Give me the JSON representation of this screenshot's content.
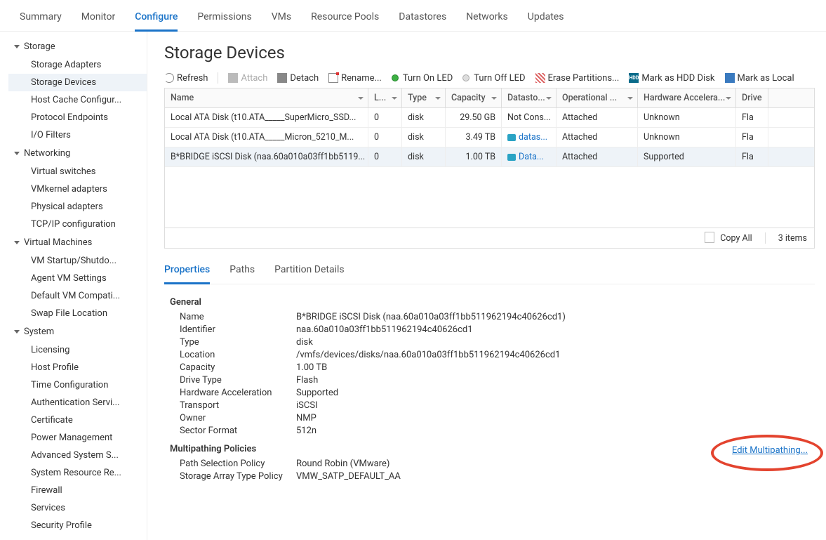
{
  "topTabs": [
    "Summary",
    "Monitor",
    "Configure",
    "Permissions",
    "VMs",
    "Resource Pools",
    "Datastores",
    "Networks",
    "Updates"
  ],
  "topTabActive": "Configure",
  "sidebar": {
    "groups": [
      {
        "label": "Storage",
        "items": [
          "Storage Adapters",
          "Storage Devices",
          "Host Cache Configur...",
          "Protocol Endpoints",
          "I/O Filters"
        ],
        "selected": "Storage Devices"
      },
      {
        "label": "Networking",
        "items": [
          "Virtual switches",
          "VMkernel adapters",
          "Physical adapters",
          "TCP/IP configuration"
        ]
      },
      {
        "label": "Virtual Machines",
        "items": [
          "VM Startup/Shutdo...",
          "Agent VM Settings",
          "Default VM Compati...",
          "Swap File Location"
        ]
      },
      {
        "label": "System",
        "items": [
          "Licensing",
          "Host Profile",
          "Time Configuration",
          "Authentication Servi...",
          "Certificate",
          "Power Management",
          "Advanced System S...",
          "System Resource Re...",
          "Firewall",
          "Services",
          "Security Profile"
        ]
      }
    ]
  },
  "page": {
    "title": "Storage Devices"
  },
  "toolbar": {
    "refresh": "Refresh",
    "attach": "Attach",
    "detach": "Detach",
    "rename": "Rename...",
    "turnOnLed": "Turn On LED",
    "turnOffLed": "Turn Off LED",
    "erase": "Erase Partitions...",
    "markHdd": "Mark as HDD Disk",
    "markLocal": "Mark as Local"
  },
  "grid": {
    "columns": {
      "name": "Name",
      "lun": "L...",
      "type": "Type",
      "capacity": "Capacity",
      "datastore": "Datasto...",
      "operational": "Operational ...",
      "hw": "Hardware Accelera...",
      "drive": "Drive"
    },
    "rows": [
      {
        "name": "Local ATA Disk (t10.ATA_____SuperMicro_SSD...",
        "lun": "0",
        "type": "disk",
        "capacity": "29.50 GB",
        "datastore": "Not Cons...",
        "dsLink": false,
        "operational": "Attached",
        "hw": "Unknown",
        "drive": "Fla"
      },
      {
        "name": "Local ATA Disk (t10.ATA_____Micron_5210_M...",
        "lun": "0",
        "type": "disk",
        "capacity": "3.49 TB",
        "datastore": "datas...",
        "dsLink": true,
        "operational": "Attached",
        "hw": "Unknown",
        "drive": "Fla"
      },
      {
        "name": "B*BRIDGE iSCSI Disk (naa.60a010a03ff1bb5119...",
        "lun": "0",
        "type": "disk",
        "capacity": "1.00 TB",
        "datastore": "Data...",
        "dsLink": true,
        "operational": "Attached",
        "hw": "Supported",
        "drive": "Fla"
      }
    ],
    "selectedIndex": 2,
    "footer": {
      "copy": "Copy All",
      "count": "3 items"
    }
  },
  "detailTabs": [
    "Properties",
    "Paths",
    "Partition Details"
  ],
  "detailTabActive": "Properties",
  "properties": {
    "generalTitle": "General",
    "general": [
      {
        "label": "Name",
        "value": "B*BRIDGE iSCSI Disk (naa.60a010a03ff1bb511962194c40626cd1)"
      },
      {
        "label": "Identifier",
        "value": "naa.60a010a03ff1bb511962194c40626cd1"
      },
      {
        "label": "Type",
        "value": "disk"
      },
      {
        "label": "Location",
        "value": "/vmfs/devices/disks/naa.60a010a03ff1bb511962194c40626cd1"
      },
      {
        "label": "Capacity",
        "value": "1.00 TB"
      },
      {
        "label": "Drive Type",
        "value": "Flash"
      },
      {
        "label": "Hardware Acceleration",
        "value": "Supported"
      },
      {
        "label": "Transport",
        "value": "iSCSI"
      },
      {
        "label": "Owner",
        "value": "NMP"
      },
      {
        "label": "Sector Format",
        "value": "512n"
      }
    ],
    "multipathTitle": "Multipathing Policies",
    "multipath": [
      {
        "label": "Path Selection Policy",
        "value": "Round Robin (VMware)"
      },
      {
        "label": "Storage Array Type Policy",
        "value": "VMW_SATP_DEFAULT_AA"
      }
    ],
    "editLink": "Edit Multipathing..."
  }
}
